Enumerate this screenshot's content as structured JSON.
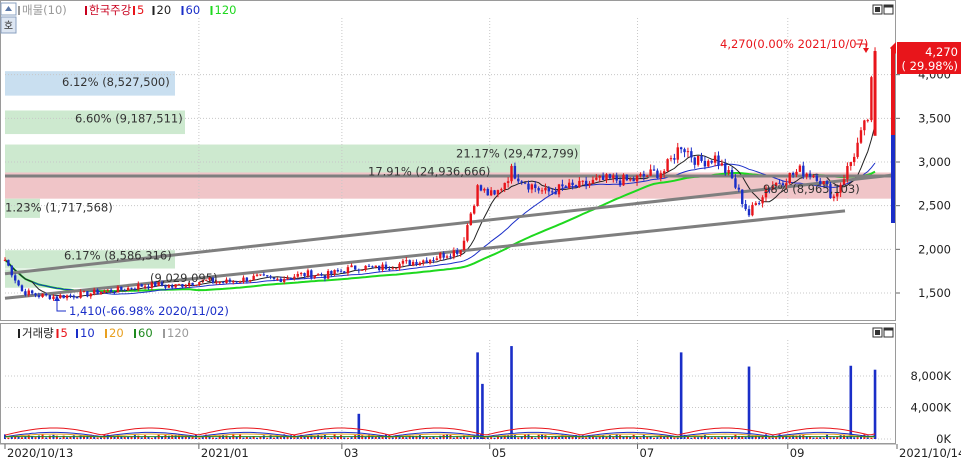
{
  "colors": {
    "up": "#e8151b",
    "down": "#1a2ec8",
    "ma5": "#222222",
    "ma20": "#1a2ec8",
    "ma60": "#1a2ec8",
    "ma120": "#1ed81e",
    "trendline": "#7f7f7f",
    "band_blue": "#c9dff0",
    "band_green": "#cde9cf",
    "band_red": "#f0c5c8",
    "grid": "#c8c8c8"
  },
  "icons": {
    "panel_toggle": "square-toggle-icon",
    "panel_restore": "window-restore-icon",
    "scroll_marker": "scroll-marker-icon"
  },
  "price_panel": {
    "side_tab": "호",
    "legend": [
      {
        "label": "매물(10)",
        "color": "#9a9a9a"
      },
      {
        "label": "한국주강",
        "color": "#c8001e"
      },
      {
        "label": "5",
        "color": "#e8151b"
      },
      {
        "label": "20",
        "color": "#222222"
      },
      {
        "label": "60",
        "color": "#1a2ec8"
      },
      {
        "label": "120",
        "color": "#1ed81e"
      }
    ],
    "annotation_max": "4,270(0.00% 2021/10/07)",
    "annotation_min": "1,410(-66.98% 2020/11/02)",
    "current_price": "4,270",
    "current_change": "( 29.98%)",
    "volume_profile": [
      "6.12% (8,527,500)",
      "6.60% (9,187,511)",
      "21.17% (29,472,799)",
      "17.91% (24,936,666)",
      "1.23% (1,717,568)",
      "6.17% (8,586,316)",
      "(9,029,095)",
      "98% (8,965,103)"
    ]
  },
  "volume_panel": {
    "legend": [
      {
        "label": "거래량",
        "color": "#222222"
      },
      {
        "label": "5",
        "color": "#e8151b"
      },
      {
        "label": "10",
        "color": "#1a2ec8"
      },
      {
        "label": "20",
        "color": "#e8a020"
      },
      {
        "label": "60",
        "color": "#1e8a1e"
      },
      {
        "label": "120",
        "color": "#9a9a9a"
      }
    ]
  },
  "x_axis_labels": [
    "2020/10/13",
    "2021/01",
    "03",
    "05",
    "07",
    "09",
    "2021/10/14"
  ],
  "chart_data": [
    {
      "type": "candlestick",
      "title": "한국주강",
      "y_ticks": [
        "1,500",
        "2,000",
        "2,500",
        "3,000",
        "3,500",
        "4,000"
      ],
      "ylim": [
        1300,
        4500
      ],
      "grid": true,
      "moving_averages": [
        "5",
        "20",
        "60",
        "120"
      ],
      "weekly_closes": [
        {
          "x": "2020/10/13",
          "close": 1880
        },
        {
          "x": "2020/10/20",
          "close": 1520
        },
        {
          "x": "2020/10/27",
          "close": 1470
        },
        {
          "x": "2020/11/02",
          "close": 1460
        },
        {
          "x": "2020/11/09",
          "close": 1470
        },
        {
          "x": "2020/11/16",
          "close": 1490
        },
        {
          "x": "2020/11/23",
          "close": 1520
        },
        {
          "x": "2020/11/30",
          "close": 1540
        },
        {
          "x": "2020/12/07",
          "close": 1580
        },
        {
          "x": "2020/12/14",
          "close": 1600
        },
        {
          "x": "2020/12/21",
          "close": 1570
        },
        {
          "x": "2020/12/28",
          "close": 1620
        },
        {
          "x": "2021/01/04",
          "close": 1640
        },
        {
          "x": "2021/01/11",
          "close": 1620
        },
        {
          "x": "2021/01/18",
          "close": 1650
        },
        {
          "x": "2021/01/25",
          "close": 1680
        },
        {
          "x": "2021/02/01",
          "close": 1650
        },
        {
          "x": "2021/02/08",
          "close": 1690
        },
        {
          "x": "2021/02/15",
          "close": 1720
        },
        {
          "x": "2021/02/22",
          "close": 1700
        },
        {
          "x": "2021/03/02",
          "close": 1760
        },
        {
          "x": "2021/03/08",
          "close": 1800
        },
        {
          "x": "2021/03/15",
          "close": 1780
        },
        {
          "x": "2021/03/22",
          "close": 1820
        },
        {
          "x": "2021/03/29",
          "close": 1850
        },
        {
          "x": "2021/04/05",
          "close": 1880
        },
        {
          "x": "2021/04/12",
          "close": 1940
        },
        {
          "x": "2021/04/19",
          "close": 2000
        },
        {
          "x": "2021/04/26",
          "close": 2700
        },
        {
          "x": "2021/05/03",
          "close": 2600
        },
        {
          "x": "2021/05/10",
          "close": 2900
        },
        {
          "x": "2021/05/17",
          "close": 2750
        },
        {
          "x": "2021/05/24",
          "close": 2650
        },
        {
          "x": "2021/05/31",
          "close": 2700
        },
        {
          "x": "2021/06/07",
          "close": 2720
        },
        {
          "x": "2021/06/14",
          "close": 2780
        },
        {
          "x": "2021/06/21",
          "close": 2800
        },
        {
          "x": "2021/06/28",
          "close": 2780
        },
        {
          "x": "2021/07/05",
          "close": 2850
        },
        {
          "x": "2021/07/12",
          "close": 2900
        },
        {
          "x": "2021/07/19",
          "close": 3200
        },
        {
          "x": "2021/07/26",
          "close": 3000
        },
        {
          "x": "2021/08/02",
          "close": 3050
        },
        {
          "x": "2021/08/09",
          "close": 2800
        },
        {
          "x": "2021/08/16",
          "close": 2400
        },
        {
          "x": "2021/08/23",
          "close": 2700
        },
        {
          "x": "2021/08/30",
          "close": 2800
        },
        {
          "x": "2021/09/06",
          "close": 2900
        },
        {
          "x": "2021/09/13",
          "close": 2850
        },
        {
          "x": "2021/09/20",
          "close": 2600
        },
        {
          "x": "2021/09/27",
          "close": 3000
        },
        {
          "x": "2021/10/04",
          "close": 3500
        },
        {
          "x": "2021/10/07",
          "close": 4270
        }
      ]
    },
    {
      "type": "bar",
      "title": "거래량",
      "y_ticks": [
        "0K",
        "4,000K",
        "8,000K"
      ],
      "ylim": [
        0,
        12000
      ],
      "series": [
        {
          "name": "거래량",
          "values": [
            {
              "x": "2021/03/08",
              "value": 3200
            },
            {
              "x": "2021/04/26",
              "value": 11000
            },
            {
              "x": "2021/04/28",
              "value": 7000
            },
            {
              "x": "2021/05/10",
              "value": 11800
            },
            {
              "x": "2021/07/19",
              "value": 11000
            },
            {
              "x": "2021/08/16",
              "value": 9200
            },
            {
              "x": "2021/09/27",
              "value": 9300
            },
            {
              "x": "2021/10/07",
              "value": 8800
            }
          ]
        }
      ]
    }
  ]
}
